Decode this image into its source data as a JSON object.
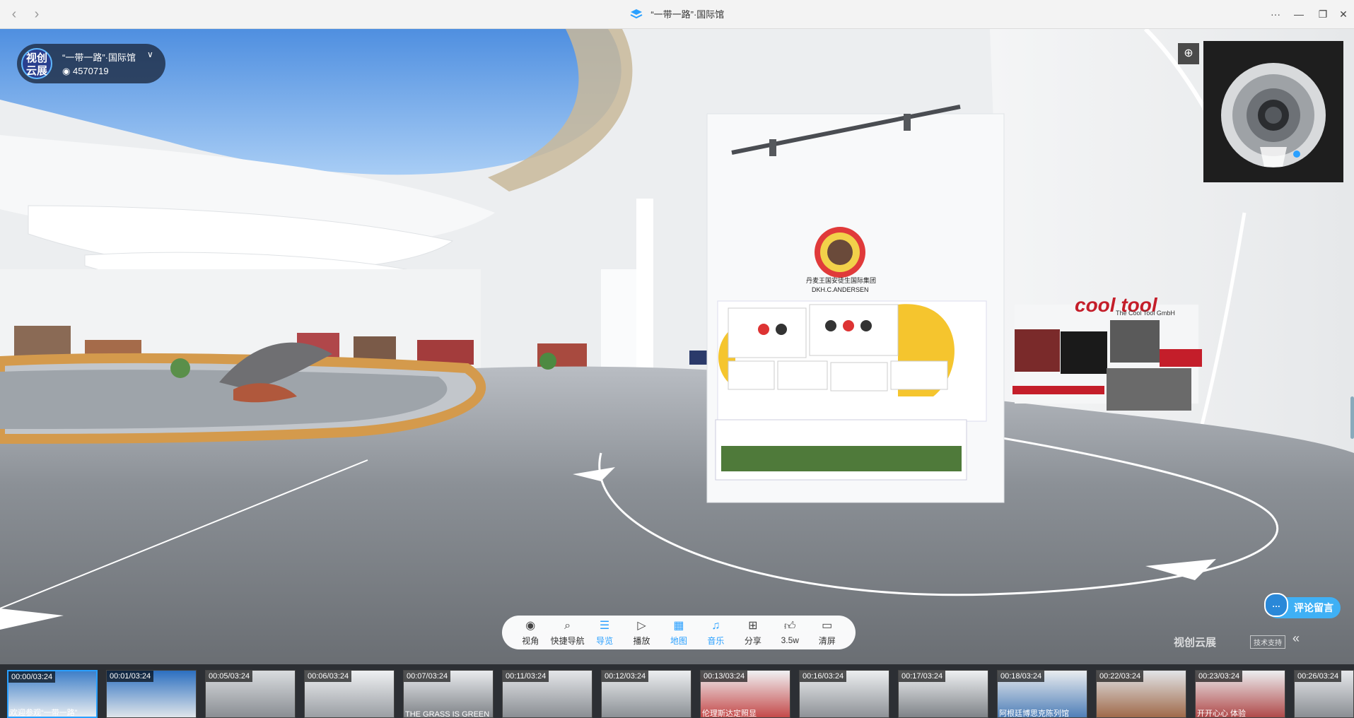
{
  "window": {
    "title": "“一带一路”·国际馆",
    "back_icon": "chevron-left-icon",
    "forward_icon": "chevron-right-icon",
    "more_label": "···",
    "minimize_label": "—",
    "restore_label": "❐",
    "close_label": "✕"
  },
  "brand": {
    "logo_text": "视创云展",
    "title": "“一带一路”·国际馆",
    "view_count": "4570719"
  },
  "scene": {
    "booth_brand": "丹麦王国安徒生国际集团",
    "booth_brand_en": "DKH.C.ANDERSEN",
    "right_booth_logo": "cool tool",
    "right_booth_name": "The Cool Tool GmbH"
  },
  "toolbar": {
    "items": [
      {
        "label": "视角",
        "icon": "eye-icon",
        "active": false
      },
      {
        "label": "快捷导航",
        "icon": "search-icon",
        "active": false
      },
      {
        "label": "导览",
        "icon": "guide-list-icon",
        "active": true
      },
      {
        "label": "播放",
        "icon": "play-icon",
        "active": false
      },
      {
        "label": "地图",
        "icon": "map-icon",
        "active": true
      },
      {
        "label": "音乐",
        "icon": "music-icon",
        "active": true
      },
      {
        "label": "分享",
        "icon": "share-icon",
        "active": false
      },
      {
        "label": "3.5w",
        "icon": "thumbs-up-icon",
        "active": false
      },
      {
        "label": "清屏",
        "icon": "clear-screen-icon",
        "active": false
      }
    ]
  },
  "comment_button": "评论留言",
  "watermark": {
    "brand": "视创云展",
    "tag": "技术支持"
  },
  "thumbnails": [
    {
      "time": "00:00/03:24",
      "caption": "欢迎参观“一带一路”",
      "selected": true
    },
    {
      "time": "00:01/03:24",
      "caption": "",
      "selected": false
    },
    {
      "time": "00:05/03:24",
      "caption": "",
      "selected": false
    },
    {
      "time": "00:06/03:24",
      "caption": "",
      "selected": false
    },
    {
      "time": "00:07/03:24",
      "caption": "THE GRASS IS GREEN",
      "selected": false
    },
    {
      "time": "00:11/03:24",
      "caption": "",
      "selected": false
    },
    {
      "time": "00:12/03:24",
      "caption": "",
      "selected": false
    },
    {
      "time": "00:13/03:24",
      "caption": "伦理斯达定照显",
      "selected": false
    },
    {
      "time": "00:16/03:24",
      "caption": "",
      "selected": false
    },
    {
      "time": "00:17/03:24",
      "caption": "",
      "selected": false
    },
    {
      "time": "00:18/03:24",
      "caption": "阿根廷博思克陈列馆",
      "selected": false
    },
    {
      "time": "00:22/03:24",
      "caption": "",
      "selected": false
    },
    {
      "time": "00:23/03:24",
      "caption": "开开心心 体验",
      "selected": false
    },
    {
      "time": "00:26/03:24",
      "caption": "",
      "selected": false
    }
  ]
}
